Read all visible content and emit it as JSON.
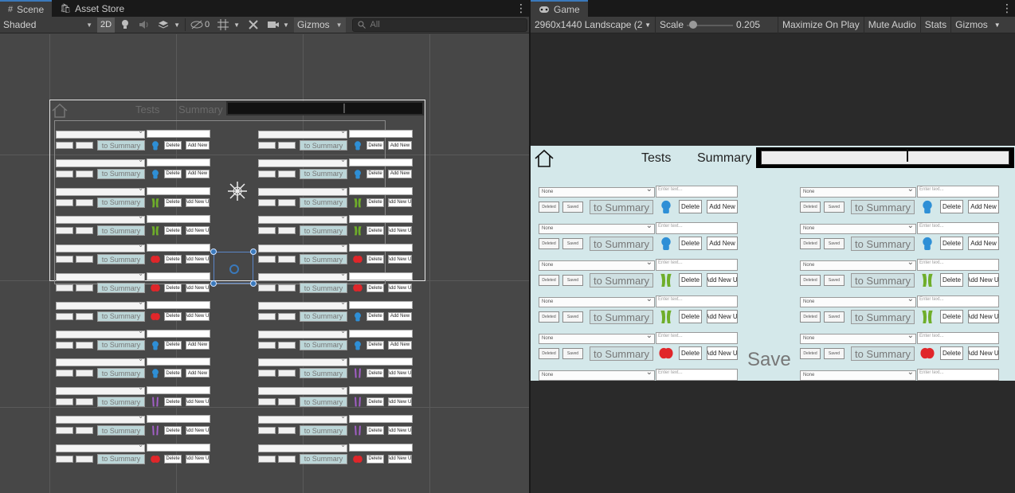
{
  "scene": {
    "tabs": [
      {
        "label": "Scene",
        "glyph": "#",
        "active": true
      },
      {
        "label": "Asset Store",
        "glyph": "🛍",
        "active": false
      }
    ],
    "toolbar": {
      "shading_mode": "Shaded",
      "toggle_2d": "2D",
      "hidden_count": "0",
      "gizmos": "Gizmos",
      "search_placeholder": "All"
    },
    "canvas_header": {
      "tests_label": "Tests",
      "summary_label": "Summary"
    },
    "row_labels": {
      "to_summary": "to Summary",
      "delete": "Delete",
      "add_new": "Add New",
      "add_new_ui": "Add New UI"
    },
    "left_column_icons": [
      "blue",
      "blue",
      "green",
      "green",
      "red",
      "red",
      "red",
      "blue",
      "blue",
      "purple",
      "purple",
      "red"
    ],
    "right_column_icons": [
      "blue",
      "blue",
      "green",
      "green",
      "red",
      "red",
      "blue",
      "blue",
      "purple",
      "purple",
      "purple",
      "red"
    ]
  },
  "game": {
    "tab_label": "Game",
    "toolbar": {
      "resolution": "2960x1440 Landscape (2",
      "scale_label": "Scale",
      "scale_value": "0.205",
      "scale_fraction": 0.02,
      "maximize_on_play": "Maximize On Play",
      "mute_audio": "Mute Audio",
      "stats": "Stats",
      "gizmos": "Gizmos"
    },
    "header": {
      "tests_label": "Tests",
      "summary_label": "Summary"
    },
    "save_label": "Save",
    "rows": {
      "dropdown_text": "None",
      "input_placeholder": "Enter text...",
      "btn1": "Deleted",
      "btn2": "Saved",
      "to_summary": "to Summary",
      "delete": "Delete",
      "add_new": "Add New",
      "add_new_ui": "Add New UI"
    },
    "left_column": [
      {
        "icon": "blue",
        "add": "Add New"
      },
      {
        "icon": "blue",
        "add": "Add New"
      },
      {
        "icon": "green",
        "add": "Add New UI"
      },
      {
        "icon": "green",
        "add": "Add New UI"
      },
      {
        "icon": "red",
        "add": "Add New UI"
      }
    ],
    "right_column": [
      {
        "icon": "blue",
        "add": "Add New"
      },
      {
        "icon": "blue",
        "add": "Add New"
      },
      {
        "icon": "green",
        "add": "Add New UI"
      },
      {
        "icon": "green",
        "add": "Add New UI"
      },
      {
        "icon": "red",
        "add": "Add New UI"
      }
    ]
  },
  "colors": {
    "blue": "#2e8fd6",
    "green": "#6fae2a",
    "red": "#e0262a",
    "purple": "#a35fc8",
    "accent": "#3a79bb"
  }
}
